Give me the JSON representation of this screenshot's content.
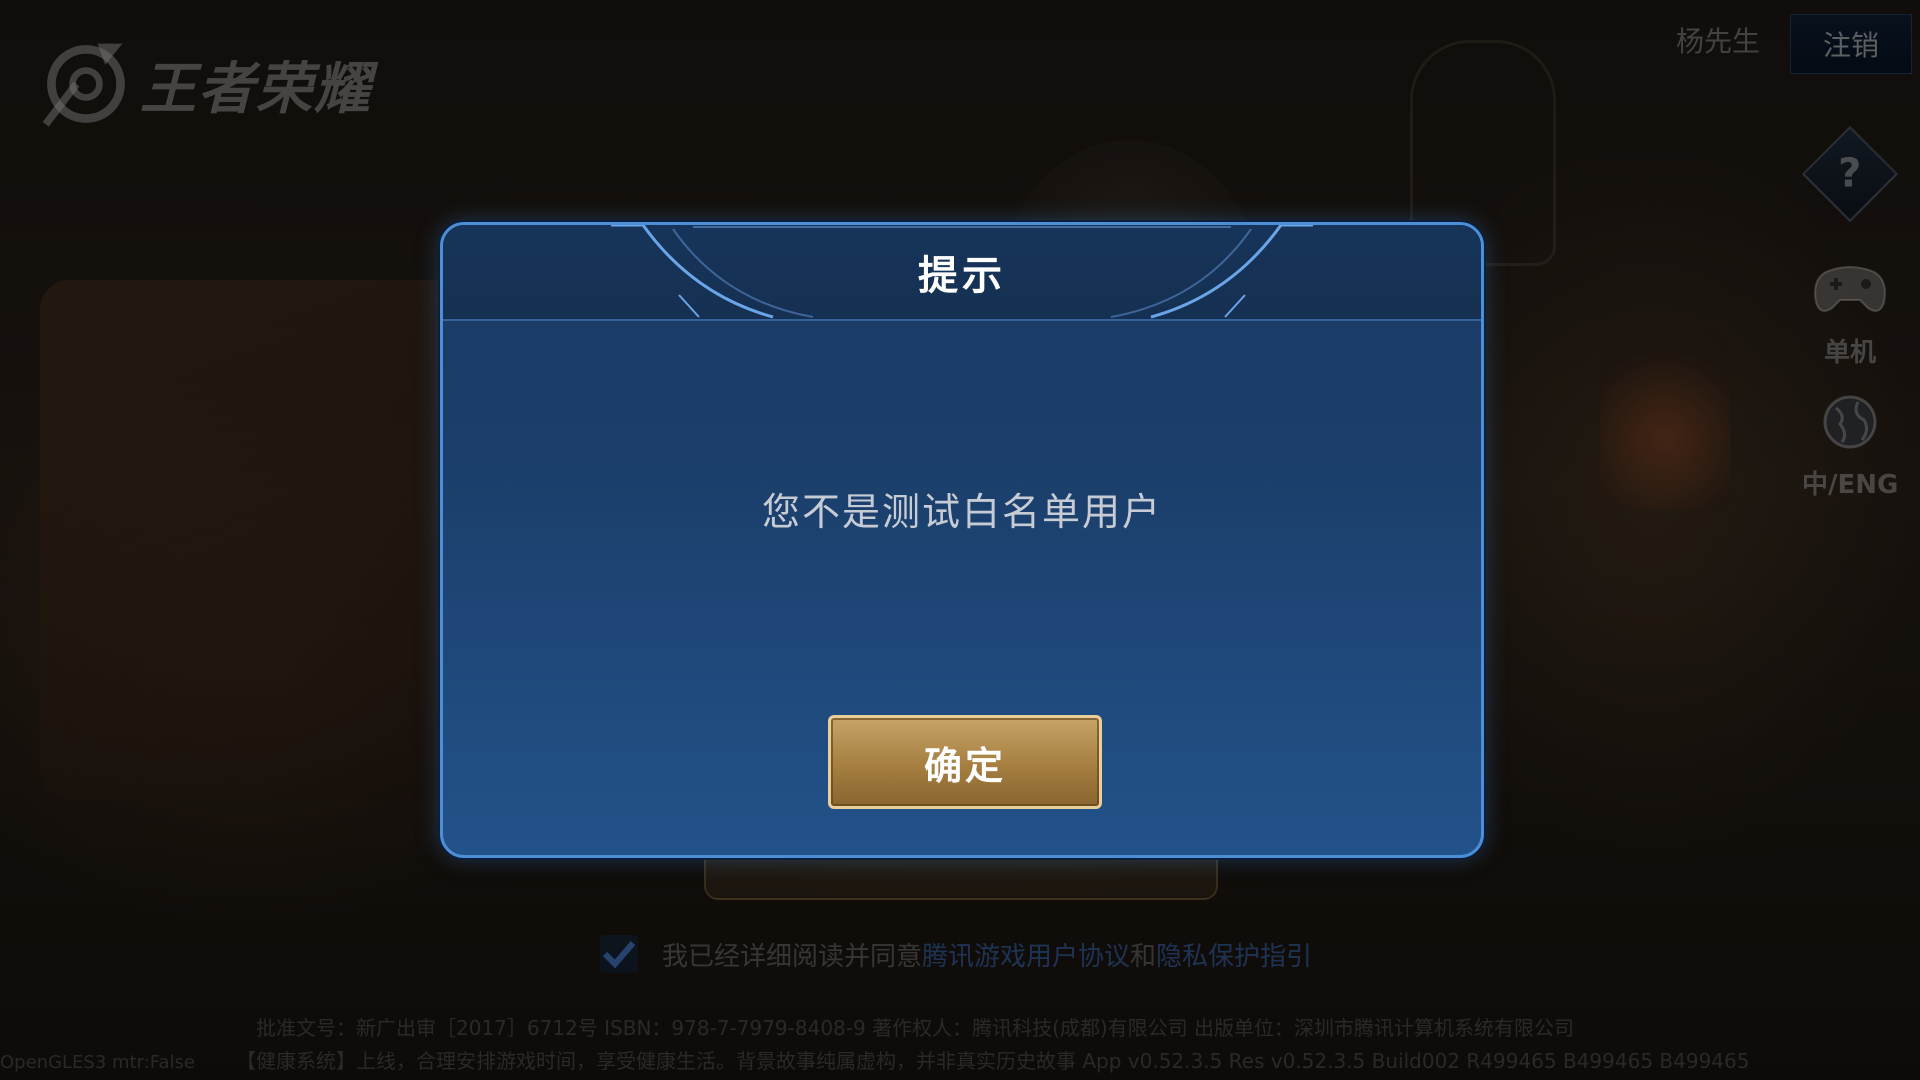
{
  "app": {
    "logo_text": "王者荣耀"
  },
  "account": {
    "username": "杨先生",
    "logout_label": "注销"
  },
  "side_buttons": {
    "help_glyph": "?",
    "offline_label": "单机",
    "language_label": "中/ENG"
  },
  "dialog": {
    "title": "提示",
    "message": "您不是测试白名单用户",
    "confirm_label": "确定"
  },
  "agreement": {
    "checked": true,
    "prefix": "我已经详细阅读并同意",
    "user_agreement": "腾讯游戏用户协议",
    "conjunction": "和",
    "privacy_guide": "隐私保护指引"
  },
  "legal": {
    "line1": "批准文号：新广出审［2017］6712号  ISBN：978-7-7979-8408-9  著作权人：腾讯科技(成都)有限公司  出版单位：深圳市腾讯计算机系统有限公司",
    "line2": "【健康系统】上线，合理安排游戏时间，享受健康生活。背景故事纯属虚构，并非真实历史故事 App v0.52.3.5 Res v0.52.3.5 Build002 R499465 B499465 B499465"
  },
  "debug": {
    "gl_info": "OpenGLES3 mtr:False"
  },
  "colors": {
    "dialog_border": "#4d8fd6",
    "dialog_bg": "#1b3f6b",
    "confirm_gold": "#a57e40",
    "link_blue": "#3c6ebe"
  },
  "icons": {
    "logo": "logo-emblem-icon",
    "help": "help-question-icon",
    "offline": "gamepad-icon",
    "language": "globe-icon",
    "checkbox": "checkmark-icon"
  }
}
